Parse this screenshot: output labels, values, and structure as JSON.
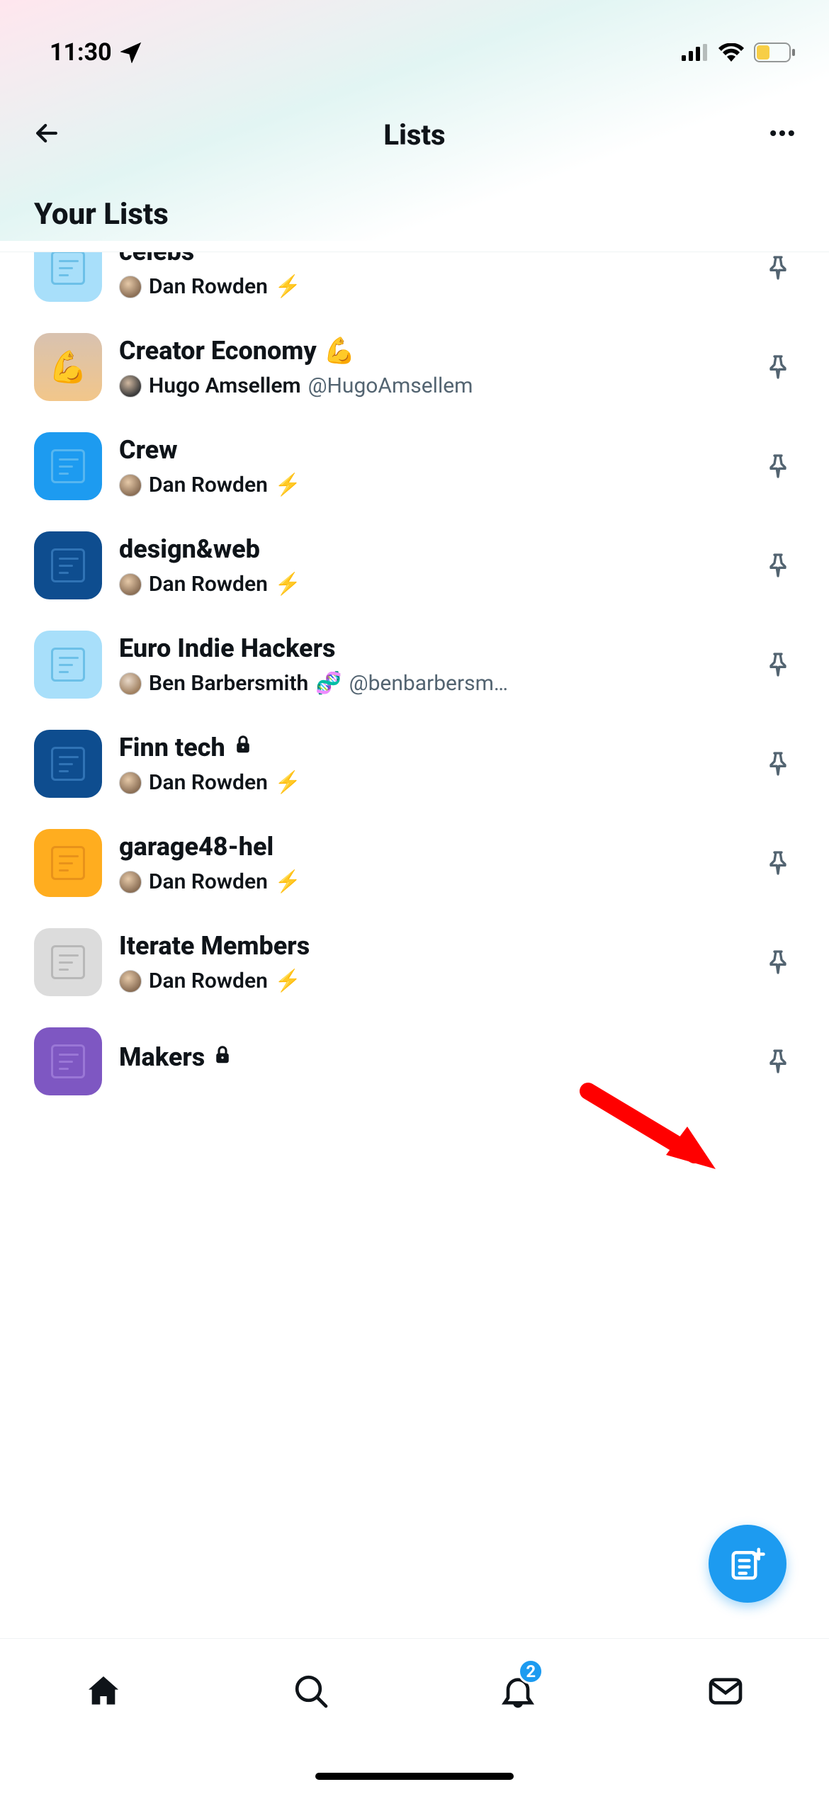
{
  "statusBar": {
    "time": "11:30"
  },
  "header": {
    "title": "Lists"
  },
  "section": {
    "title": "Your Lists"
  },
  "lists": [
    {
      "name": "celebs",
      "emoji": "",
      "author": "Dan Rowden",
      "handle": "",
      "badge": "⚡",
      "thumb": "t-lightblue",
      "thumbIcon": "doc",
      "avatar": "dan"
    },
    {
      "name": "Creator Economy",
      "emoji": "💪",
      "author": "Hugo Amsellem",
      "handle": "@HugoAmsellem",
      "badge": "",
      "thumb": "t-orange-grad",
      "thumbIcon": "emoji",
      "thumbEmoji": "💪",
      "avatar": "alt"
    },
    {
      "name": "Crew",
      "emoji": "",
      "author": "Dan Rowden",
      "handle": "",
      "badge": "⚡",
      "thumb": "t-blue",
      "thumbIcon": "doc",
      "avatar": "dan"
    },
    {
      "name": "design&web",
      "emoji": "",
      "author": "Dan Rowden",
      "handle": "",
      "badge": "⚡",
      "thumb": "t-darkblue",
      "thumbIcon": "doc",
      "avatar": "dan"
    },
    {
      "name": "Euro Indie Hackers",
      "emoji": "",
      "author": "Ben Barbersmith",
      "handle": "@benbarbersm…",
      "badge": "🧬",
      "thumb": "t-lightblue",
      "thumbIcon": "doc",
      "avatar": "ben"
    },
    {
      "name": "Finn tech",
      "emoji": "🔒",
      "author": "Dan Rowden",
      "handle": "",
      "badge": "⚡",
      "thumb": "t-darkblue",
      "thumbIcon": "doc",
      "avatar": "dan",
      "lock": true
    },
    {
      "name": "garage48-hel",
      "emoji": "",
      "author": "Dan Rowden",
      "handle": "",
      "badge": "⚡",
      "thumb": "t-yellow",
      "thumbIcon": "doc",
      "avatar": "dan"
    },
    {
      "name": "Iterate Members",
      "emoji": "",
      "author": "Dan Rowden",
      "handle": "",
      "badge": "⚡",
      "thumb": "t-grey",
      "thumbIcon": "doc",
      "avatar": "dan"
    },
    {
      "name": "Makers",
      "emoji": "🔒",
      "author": "",
      "handle": "",
      "badge": "",
      "thumb": "t-purple",
      "thumbIcon": "doc",
      "avatar": "",
      "lock": true
    }
  ],
  "nav": {
    "badge": "2"
  }
}
